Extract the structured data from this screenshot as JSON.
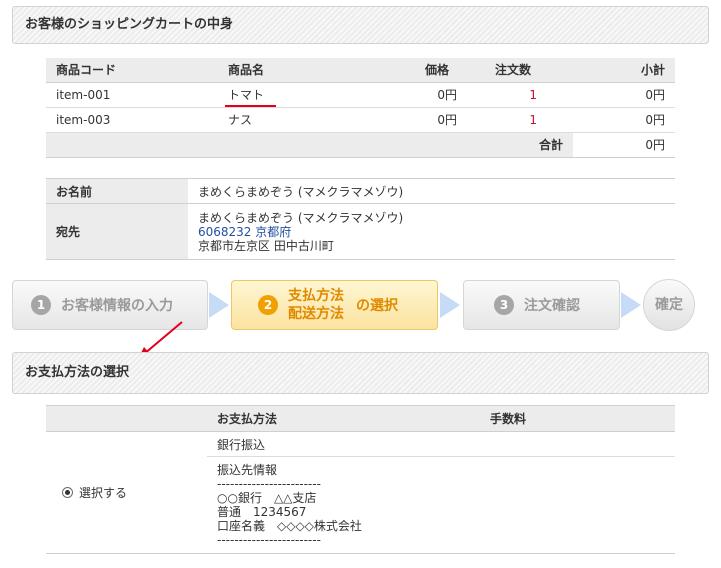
{
  "cart_section": {
    "title": "お客様のショッピングカートの中身"
  },
  "cart": {
    "columns": [
      "商品コード",
      "商品名",
      "価格",
      "注文数",
      "小計"
    ],
    "rows": [
      {
        "code": "item-001",
        "name": "トマト",
        "price": "0円",
        "qty": "1",
        "subtotal": "0円"
      },
      {
        "code": "item-003",
        "name": "ナス",
        "price": "0円",
        "qty": "1",
        "subtotal": "0円"
      }
    ],
    "total_label": "合計",
    "total_value": "0円"
  },
  "customer": {
    "name_label": "お名前",
    "name_value": "まめくらまめぞう (マメクラマメゾウ)",
    "address_label": "宛先",
    "address_name": "まめくらまめぞう (マメクラマメゾウ)",
    "address_line1": "6068232 京都府",
    "address_line2": "京都市左京区 田中古川町"
  },
  "steps": {
    "step1": {
      "num": "1",
      "label": "お客様情報の入力"
    },
    "step2": {
      "num": "2",
      "line1": "支払方法",
      "line2": "配送方法",
      "suffix": "の選択"
    },
    "step3": {
      "num": "3",
      "label": "注文確認"
    },
    "step4": {
      "label": "確定"
    }
  },
  "payment_section": {
    "title": "お支払方法の選択"
  },
  "payment": {
    "col_method": "お支払方法",
    "col_fee": "手数料",
    "select_label": "選択する",
    "method_name": "銀行振込",
    "fee": "",
    "details_title": "振込先情報",
    "separator": "------------------------",
    "bank_line": "○○銀行　△△支店",
    "account_line": "普通　1234567",
    "holder_line": "口座名義　◇◇◇◇株式会社",
    "separator_end": "------------------------"
  },
  "colors": {
    "active_step": "#e08a00",
    "quantity": "#c8102e",
    "annotation": "#e2001a",
    "postal": "#2050a0"
  }
}
